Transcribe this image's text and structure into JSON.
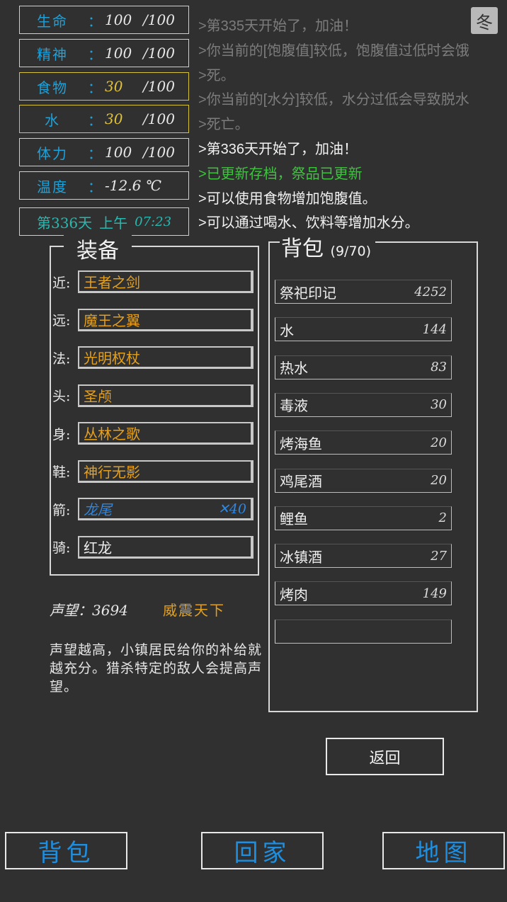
{
  "stats": [
    {
      "label": "生命",
      "current": "100",
      "max": "/100",
      "low": false
    },
    {
      "label": "精神",
      "current": "100",
      "max": "/100",
      "low": false
    },
    {
      "label": "食物",
      "current": "30",
      "max": "/100",
      "low": true
    },
    {
      "label": "水",
      "current": "30",
      "max": "/100",
      "low": true
    },
    {
      "label": "体力",
      "current": "100",
      "max": "/100",
      "low": false
    }
  ],
  "temperature": {
    "label": "温度",
    "value": "-12.6 ℃"
  },
  "colon": "：",
  "day": {
    "day_label": "第336天",
    "period": "上午",
    "time": "07:23"
  },
  "season": "冬",
  "log": [
    {
      "text": ">第335天开始了，加油！",
      "style": "old"
    },
    {
      "text": ">你当前的[饱腹值]较低，饱腹值过低时会饿",
      "style": "old"
    },
    {
      "text": ">死。",
      "style": "old"
    },
    {
      "text": ">你当前的[水分]较低，水分过低会导致脱水",
      "style": "old"
    },
    {
      "text": ">死亡。",
      "style": "old"
    },
    {
      "text": ">第336天开始了，加油！",
      "style": "new"
    },
    {
      "text": ">已更新存档，祭品已更新",
      "style": "green"
    },
    {
      "text": ">可以使用食物增加饱腹值。",
      "style": "new"
    },
    {
      "text": ">可以通过喝水、饮料等增加水分。",
      "style": "new"
    }
  ],
  "equipment": {
    "title": "装备",
    "slots": [
      {
        "label": "近:",
        "item": "王者之剑",
        "color": "gold",
        "qty": ""
      },
      {
        "label": "远:",
        "item": "魔王之翼",
        "color": "gold",
        "qty": ""
      },
      {
        "label": "法:",
        "item": "光明权杖",
        "color": "gold",
        "qty": ""
      },
      {
        "label": "头:",
        "item": "圣颅",
        "color": "gold",
        "qty": ""
      },
      {
        "label": "身:",
        "item": "丛林之歌",
        "color": "gold",
        "qty": ""
      },
      {
        "label": "鞋:",
        "item": "神行无影",
        "color": "gold",
        "qty": ""
      },
      {
        "label": "箭:",
        "item": "龙尾",
        "color": "blue",
        "qty": "✕40"
      },
      {
        "label": "骑:",
        "item": "红龙",
        "color": "white",
        "qty": ""
      }
    ]
  },
  "reputation": {
    "label": "声望：3694",
    "title": "威震天下"
  },
  "description": "声望越高，小镇居民给你的补给就越充分。猎杀特定的敌人会提高声望。",
  "backpack": {
    "title": "背包",
    "count": "(9/70)",
    "items": [
      {
        "name": "祭祀印记",
        "qty": "4252"
      },
      {
        "name": "水",
        "qty": "144"
      },
      {
        "name": "热水",
        "qty": "83"
      },
      {
        "name": "毒液",
        "qty": "30"
      },
      {
        "name": "烤海鱼",
        "qty": "20"
      },
      {
        "name": "鸡尾酒",
        "qty": "20"
      },
      {
        "name": "鲤鱼",
        "qty": "2"
      },
      {
        "name": "冰镇酒",
        "qty": "27"
      },
      {
        "name": "烤肉",
        "qty": "149"
      },
      {
        "name": "",
        "qty": ""
      }
    ]
  },
  "buttons": {
    "back": "返回",
    "nav_bag": "背包",
    "nav_home": "回家",
    "nav_map": "地图"
  }
}
